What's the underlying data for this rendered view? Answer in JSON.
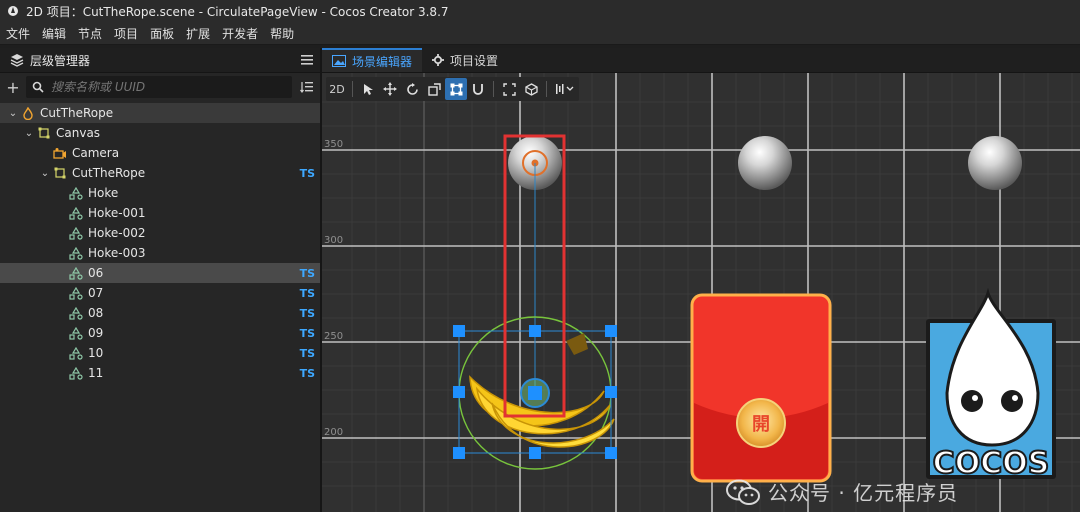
{
  "window": {
    "title": "2D 项目：CutTheRope.scene - CirculatePageView - Cocos Creator 3.8.7"
  },
  "menu": [
    "文件",
    "编辑",
    "节点",
    "项目",
    "面板",
    "扩展",
    "开发者",
    "帮助"
  ],
  "hierarchy": {
    "title": "层级管理器",
    "search_placeholder": "搜索名称或 UUID",
    "nodes": [
      {
        "label": "CutTheRope",
        "ts": ""
      },
      {
        "label": "Canvas",
        "ts": ""
      },
      {
        "label": "Camera",
        "ts": ""
      },
      {
        "label": "CutTheRope",
        "ts": "TS"
      },
      {
        "label": "Hoke",
        "ts": ""
      },
      {
        "label": "Hoke-001",
        "ts": ""
      },
      {
        "label": "Hoke-002",
        "ts": ""
      },
      {
        "label": "Hoke-003",
        "ts": ""
      },
      {
        "label": "06",
        "ts": "TS"
      },
      {
        "label": "07",
        "ts": "TS"
      },
      {
        "label": "08",
        "ts": "TS"
      },
      {
        "label": "09",
        "ts": "TS"
      },
      {
        "label": "10",
        "ts": "TS"
      },
      {
        "label": "11",
        "ts": "TS"
      }
    ]
  },
  "scene_tabs": [
    {
      "label": "场景编辑器"
    },
    {
      "label": "项目设置"
    }
  ],
  "toolbar": {
    "mode_label": "2D"
  },
  "axis_labels": [
    "350",
    "300",
    "250",
    "200"
  ],
  "scene_text": {
    "envelope_char": "開",
    "logo_text": "COCOS"
  },
  "watermark": "公众号 · 亿元程序员"
}
